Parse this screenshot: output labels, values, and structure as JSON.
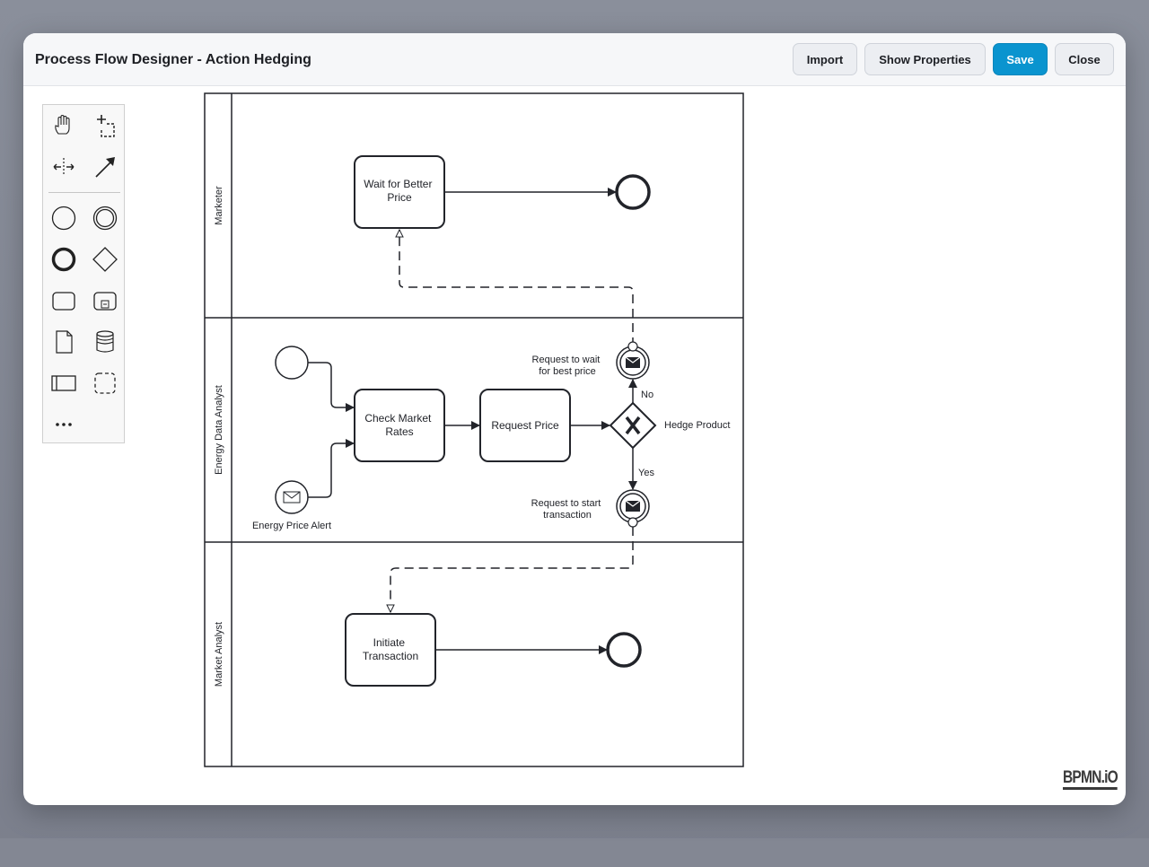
{
  "window": {
    "title": "Process Flow Designer - Action Hedging"
  },
  "toolbar": {
    "import_label": "Import",
    "show_properties_label": "Show Properties",
    "save_label": "Save",
    "close_label": "Close"
  },
  "palette": {
    "tools": [
      "hand-tool",
      "lasso-tool",
      "space-tool",
      "connect-tool",
      "start-event",
      "intermediate-event",
      "end-event",
      "gateway",
      "task",
      "subprocess",
      "data-object",
      "data-store",
      "pool",
      "group",
      "more"
    ]
  },
  "diagram": {
    "lanes": [
      "Marketer",
      "Energy Data Analyst",
      "Market Analyst"
    ],
    "tasks": {
      "wait_better_price": [
        "Wait for Better",
        "Price"
      ],
      "check_market_rates": [
        "Check Market",
        "Rates"
      ],
      "request_price": "Request Price",
      "initiate_transaction": [
        "Initiate",
        "Transaction"
      ]
    },
    "gateway_label": "Hedge Product",
    "flow_labels": {
      "no": "No",
      "yes": "Yes"
    },
    "events": {
      "energy_price_alert": "Energy Price Alert",
      "request_wait": [
        "Request to wait",
        "for best price"
      ],
      "request_start": [
        "Request to start",
        "transaction"
      ]
    }
  },
  "branding": {
    "logo_text": "BPMN.iO"
  },
  "colors": {
    "primary": "#0a94cf",
    "stroke": "#22242a"
  }
}
